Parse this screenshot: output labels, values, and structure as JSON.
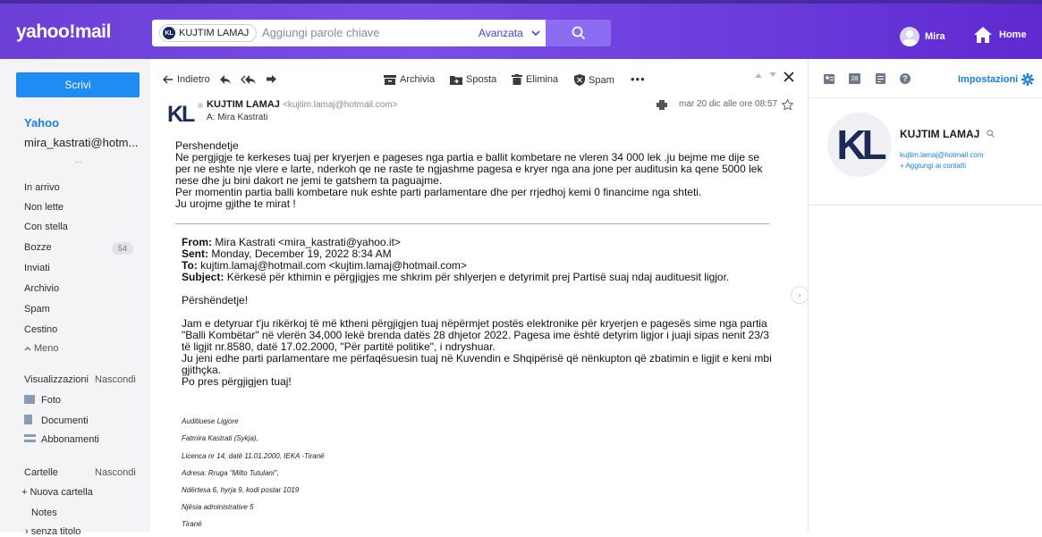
{
  "brand": {
    "logo": "yahoo!mail"
  },
  "search": {
    "chip": "KUJTIM LAMAJ",
    "chip_initials": "KL",
    "placeholder": "Aggiungi parole chiave",
    "advanced": "Avanzata"
  },
  "header": {
    "user": "Mira",
    "home": "Home"
  },
  "sidebar": {
    "compose": "Scrivi",
    "account_name": "Yahoo",
    "account_email": "mira_kastrati@hotm...",
    "account_more": "...",
    "folders": [
      {
        "label": "In arrivo"
      },
      {
        "label": "Non lette"
      },
      {
        "label": "Con stella"
      },
      {
        "label": "Bozze",
        "count": "54"
      },
      {
        "label": "Inviati"
      },
      {
        "label": "Archivio"
      },
      {
        "label": "Spam"
      },
      {
        "label": "Cestino"
      },
      {
        "label": "Meno"
      }
    ],
    "views_title": "Visualizzazioni",
    "views_hide": "Nascondi",
    "views": [
      "Foto",
      "Documenti",
      "Abbonamenti"
    ],
    "folders_title": "Cartelle",
    "folders_hide": "Nascondi",
    "new_folder": "+ Nuova cartella",
    "notes": "Notes",
    "untitled": "senza titolo"
  },
  "toolbar": {
    "back": "Indietro",
    "archive": "Archivia",
    "move": "Sposta",
    "delete": "Elimina",
    "spam": "Spam",
    "more": "•••"
  },
  "message": {
    "sender_name": "KUJTIM LAMAJ",
    "sender_email": "<kujtim.lamaj@hotmail.com>",
    "to": "A: Mira Kastrati",
    "date": "mar 20 dic alle ore 08:57",
    "avatar_initials": "KL",
    "greeting": "Pershendetje",
    "para1": "Ne pergjigje te kerkeses  tuaj  per kryerjen e pageses nga partia e ballit  kombetare  ne  vleren 34 000  lek .ju  bejme me dije  se per ne  eshte  nje  vlere  e larte,  nderkoh  qe ne  raste  te ngjashme pagesa e kryer  nga  ana  jone per auditusin  ka  qene  5000  lek  nese  dhe ju  bini  dakort  ne jemi te gatshem ta paguajme.",
    "para2": "Per  momentin  partia  balli kombetare nuk  eshte parti parlamentare dhe per rrjedhoj  kemi 0  financime  nga  shteti.",
    "para3": "Ju  urojme gjithe  te  mirat !"
  },
  "quoted": {
    "from_label": "From:",
    "from": "Mira Kastrati <mira_kastrati@yahoo.it>",
    "sent_label": "Sent:",
    "sent": "Monday, December 19, 2022 8:34 AM",
    "to_label": "To:",
    "to": "kujtim.lamaj@hotmail.com <kujtim.lamaj@hotmail.com>",
    "subject_label": "Subject:",
    "subject": "Kërkesë për kthimin e përgjigjes me shkrim për shlyerjen e detyrimit prej Partisë suaj ndaj audituesit ligjor.",
    "greeting": "Përshëndetje!",
    "para1": "Jam e detyruar t'ju rikërkoj të më ktheni përgjigjen tuaj nëpërmjet postës elektronike për kryerjen e pagesës sime nga partia \"Balli Kombëtar\" në vlerën 34,000 lekë brenda datës 28 dhjetor 2022. Pagesa ime është detyrim ligjor i juaji sipas nenit 23/3 të ligjit nr.8580, datë 17.02.2000,  \"Për partitë politike\", i ndryshuar.",
    "para2": "Ju jeni edhe parti parlamentare me përfaqësuesin tuaj në Kuvendin e Shqipërisë që nënkupton që zbatimin e ligjit e keni mbi gjithçka.",
    "para3": "Po pres përgjigjen tuaj!",
    "sig": [
      "Auditiuese Ligjore",
      "Fatmira Kastrati (Sykja),",
      "Licenca nr 14, datë 11.01.2000, IEKA -Tiranë",
      "Adresa: Rruga \"Milto Tutulani\",",
      "Ndërtesa 6, hyrja 9, kodi postar 1019",
      "Njësia administrative 5",
      "Tiranë"
    ]
  },
  "right": {
    "settings": "Impostazioni",
    "calendar_day": "28",
    "contact_name": "KUJTIM LAMAJ",
    "contact_email": "kujtim.lamaj@hotmail.com",
    "add_contact": "+ Aggiungi ai contatti",
    "contact_initials": "KL"
  },
  "colors": {
    "brand": "#6b3fd6",
    "link": "#1b7fd9",
    "compose": "#1e8cf3"
  }
}
